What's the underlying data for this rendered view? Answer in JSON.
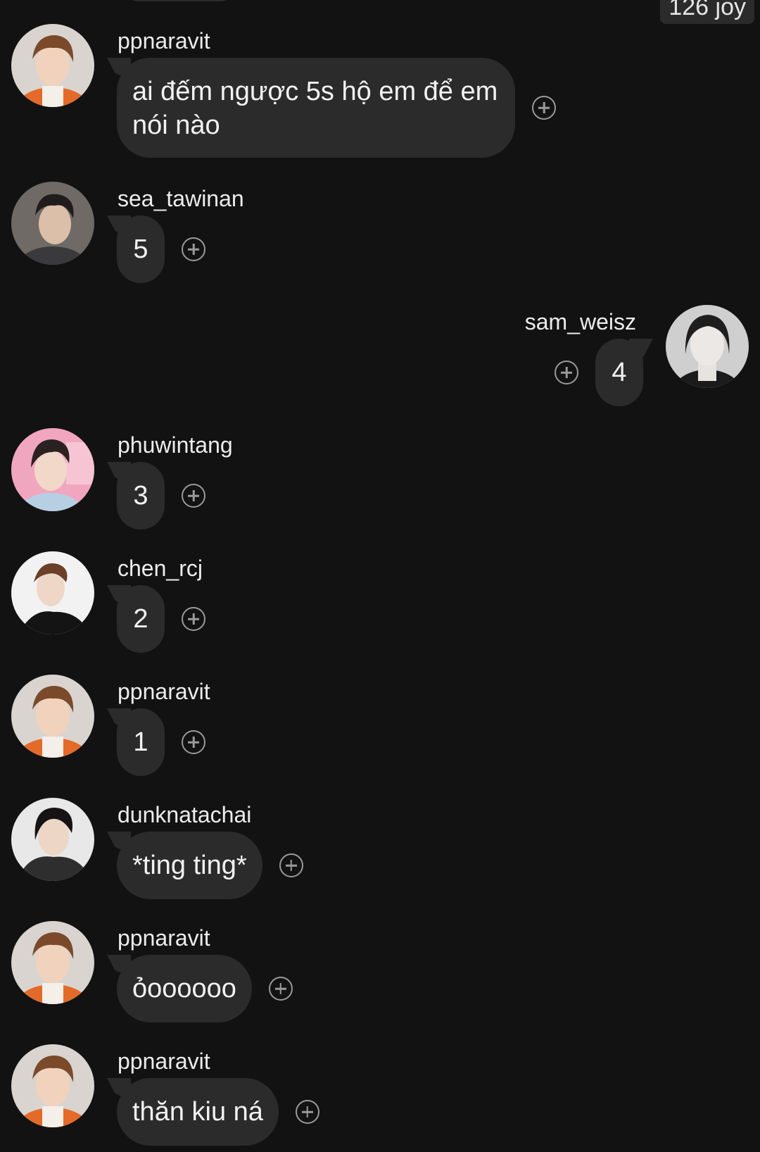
{
  "top_reaction": "126 joy",
  "colors": {
    "background": "#121213",
    "bubble": "#2b2b2c",
    "text": "#f2f2f2",
    "icon": "#9a9a9c"
  },
  "messages": [
    {
      "username": "ppnaravit",
      "text": "ai đếm ngược 5s hộ em để em nói nào",
      "side": "left",
      "avatar": "avatar-ppnaravit"
    },
    {
      "username": "sea_tawinan",
      "text": "5",
      "side": "left",
      "avatar": "avatar-sea_tawinan"
    },
    {
      "username": "sam_weisz",
      "text": "4",
      "side": "right",
      "avatar": "avatar-sam_weisz"
    },
    {
      "username": "phuwintang",
      "text": "3",
      "side": "left",
      "avatar": "avatar-phuwintang"
    },
    {
      "username": "chen_rcj",
      "text": "2",
      "side": "left",
      "avatar": "avatar-chen_rcj"
    },
    {
      "username": "ppnaravit",
      "text": "1",
      "side": "left",
      "avatar": "avatar-ppnaravit"
    },
    {
      "username": "dunknatachai",
      "text": "*ting ting*",
      "side": "left",
      "avatar": "avatar-dunknatachai"
    },
    {
      "username": "ppnaravit",
      "text": "ỏoooooo",
      "side": "left",
      "avatar": "avatar-ppnaravit"
    },
    {
      "username": "ppnaravit",
      "text": "thăn kiu ná",
      "side": "left",
      "avatar": "avatar-ppnaravit"
    }
  ],
  "add_reaction_icon": "plus-circle-icon"
}
